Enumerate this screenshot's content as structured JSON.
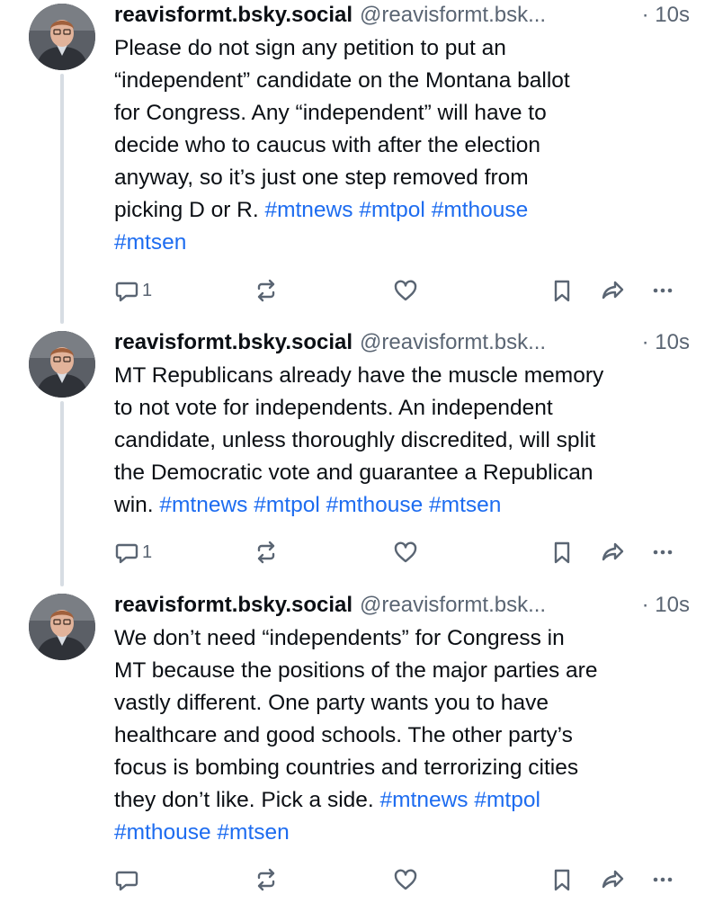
{
  "posts": [
    {
      "display_name": "reavisformt.bsky.social",
      "handle": "@reavisformt.bsk...",
      "time": "· 10s",
      "text_lines": [
        "Please do not sign any petition to put an",
        "“independent” candidate on the Montana ballot",
        "for Congress. Any “independent” will have to",
        "decide who to caucus with after the election",
        "anyway, so it’s just one step removed from"
      ],
      "last_line_text": "picking D or R. ",
      "hashtags": [
        "#mtnews",
        "#mtpol",
        "#mthouse",
        "#mtsen"
      ],
      "reply_count": "1"
    },
    {
      "display_name": "reavisformt.bsky.social",
      "handle": "@reavisformt.bsk...",
      "time": "· 10s",
      "text_lines": [
        "MT Republicans already have the muscle memory",
        "to not vote for independents. An independent",
        "candidate, unless thoroughly discredited, will split",
        "the Democratic vote and guarantee a Republican"
      ],
      "last_line_text": "win. ",
      "hashtags": [
        "#mtnews",
        "#mtpol",
        "#mthouse",
        "#mtsen"
      ],
      "reply_count": "1"
    },
    {
      "display_name": "reavisformt.bsky.social",
      "handle": "@reavisformt.bsk...",
      "time": "· 10s",
      "text_lines": [
        "We don’t need “independents” for Congress in",
        "MT because the positions of the major parties are",
        "vastly different. One party wants you to have",
        "healthcare and good schools. The other party’s",
        "focus is bombing countries and terrorizing cities"
      ],
      "last_line_text": "they don’t like. Pick a side. ",
      "hashtags": [
        "#mtnews",
        "#mtpol",
        "#mthouse",
        "#mtsen"
      ],
      "reply_count": ""
    }
  ],
  "icons": {
    "reply": "reply-icon",
    "repost": "repost-icon",
    "like": "heart-icon",
    "bookmark": "bookmark-icon",
    "share": "share-icon",
    "more": "more-icon"
  },
  "colors": {
    "hashtag": "#1d6cf0",
    "muted": "#5a6573",
    "thread_line": "#d7dde3"
  }
}
